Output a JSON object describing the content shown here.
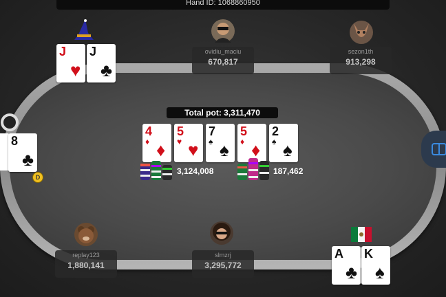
{
  "header": {
    "hand_id": "Hand ID: 1068860950"
  },
  "pot": {
    "label": "Total pot: 3,311,470"
  },
  "board": [
    {
      "rank": "4",
      "suit": "♦",
      "color": "red"
    },
    {
      "rank": "5",
      "suit": "♥",
      "color": "red"
    },
    {
      "rank": "7",
      "suit": "♠",
      "color": "black"
    },
    {
      "rank": "5",
      "suit": "♦",
      "color": "red"
    },
    {
      "rank": "2",
      "suit": "♠",
      "color": "black"
    }
  ],
  "bets": [
    {
      "amount": "3,124,008"
    },
    {
      "amount": "187,462"
    }
  ],
  "players": [
    {
      "name": "ovidiu_maciu",
      "chips": "670,817"
    },
    {
      "name": "sezon1th",
      "chips": "913,298"
    },
    {
      "name": "replay123",
      "chips": "1,880,141"
    },
    {
      "name": "slmzrj",
      "chips": "3,295,772"
    }
  ],
  "hero_cards": [
    {
      "rank": "A",
      "suit": "♣",
      "color": "black"
    },
    {
      "rank": "K",
      "suit": "♠",
      "color": "black"
    }
  ],
  "villain_cards": [
    {
      "rank": "J",
      "suit": "♥",
      "color": "red"
    },
    {
      "rank": "J",
      "suit": "♣",
      "color": "black"
    }
  ],
  "left_player_card": {
    "rank": "8",
    "suit": "♣",
    "color": "black"
  },
  "dealer_button": {
    "label": "D"
  },
  "colors": {
    "felt": "#4a4a4a",
    "rail": "#9a9a9a",
    "pot_bg": "#0d0d0d"
  }
}
